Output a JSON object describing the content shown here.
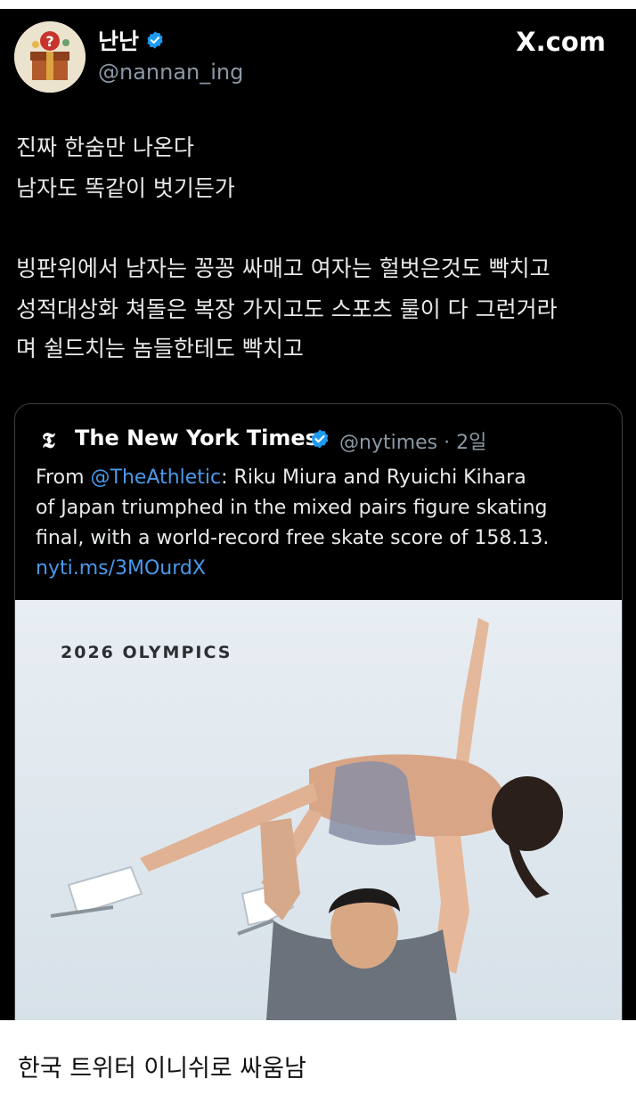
{
  "tweet": {
    "author_name": "난난",
    "handle": "@nannan_ing",
    "site": "X.com",
    "body_lines": [
      "진짜 한숨만 나온다",
      "남자도 똑같이 벗기든가",
      "빙판위에서 남자는 꽁꽁 싸매고 여자는 헐벗은것도 빡치고",
      "성적대상화 쳐돌은 복장 가지고도 스포츠 룰이 다 그런거라",
      "며 쉴드치는 놈들한테도 빡치고"
    ]
  },
  "quoted": {
    "logo": "𝕿",
    "name": "The New York Times",
    "handle": "@nytimes",
    "time": "· 2일",
    "line1_prefix": "From ",
    "line1_mention": "@TheAthletic",
    "line1_rest": ": Riku Miura and Ryuichi Kihara",
    "line2": "of Japan triumphed in the mixed pairs figure skating",
    "line3": "final, with a world-record free skate score of 158.13.",
    "link": "nyti.ms/3MOurdX",
    "image_label": "2026 OLYMPICS"
  },
  "caption": "한국 트위터 이니쉬로 싸움남",
  "colors": {
    "background": "#000000",
    "text": "#e7e9ea",
    "muted": "#8b98a5",
    "link": "#4a99e9",
    "verified": "#1d9bf0"
  }
}
